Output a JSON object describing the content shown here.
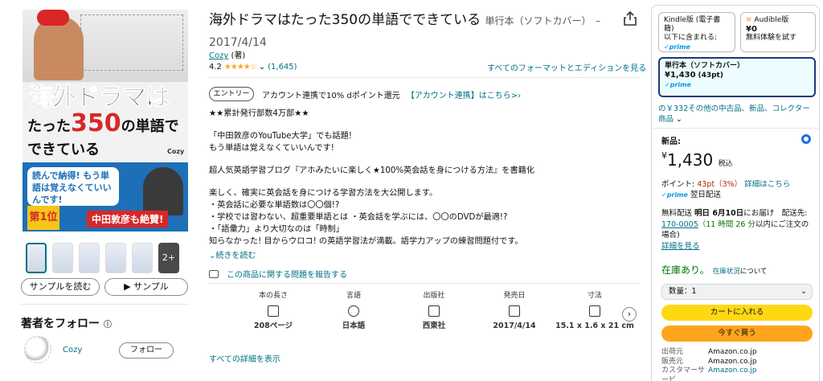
{
  "cover": {
    "title_line1": "海外ドラマは",
    "title_line2_a": "たった",
    "title_line2_num": "350",
    "title_line2_b": "の単語で",
    "title_line3": "できている",
    "brand": "Cozy",
    "bubble_text": "読んで納得! もう単語は覚えなくていいんです!",
    "rank_text": "第1位",
    "endorser": "中田敦彦も絶賛!"
  },
  "thumbnails": {
    "more_label": "2+"
  },
  "sample": {
    "read_label": "サンプルを読む",
    "play_label": "▶ サンプル"
  },
  "follow": {
    "title": "著者をフォロー",
    "author_name": "Cozy",
    "follow_label": "フォロー"
  },
  "product": {
    "title": "海外ドラマはたった350の単語でできている",
    "format": "単行本（ソフトカバー）",
    "dash": "–",
    "date": "2017/4/14",
    "author": "Cozy",
    "author_role": "(著)",
    "rating": "4.2",
    "stars": "★★★★☆",
    "rating_count": "(1,645)",
    "formats_link": "すべてのフォーマットとエディションを見る"
  },
  "entry": {
    "badge": "エントリー",
    "text": "アカウント連携で10% dポイント還元",
    "link": "【アカウント連携】はこちら>›"
  },
  "description": [
    "★★累計発行部数4万部★★",
    "",
    "「中田敦彦のYouTube大学」でも話題!",
    "もう単語は覚えなくていいんです!",
    "",
    "超人気英語学習ブログ『アホみたいに楽しく★100%英会話を身につける方法』を書籍化",
    "",
    "楽しく、確実に英会話を身につける学習方法を大公開します。",
    "・英会話に必要な単語数は〇〇個!?",
    "・学校では習わない、超重要単語とは ・英会話を学ぶには、〇〇のDVDが最適!?",
    "・「語彙力」より大切なのは「時制」",
    "知らなかった! 目からウロコ! の英語学習法が満載。語学力アップの練習問題付です。"
  ],
  "read_more": "続きを読む",
  "report": "この商品に関する問題を報告する",
  "details": [
    {
      "label": "本の長さ",
      "icon": "book-length-icon",
      "value": "208ページ"
    },
    {
      "label": "言語",
      "icon": "globe-icon",
      "value": "日本語"
    },
    {
      "label": "出版社",
      "icon": "building-icon",
      "value": "西東社"
    },
    {
      "label": "発売日",
      "icon": "calendar-icon",
      "value": "2017/4/14"
    },
    {
      "label": "寸法",
      "icon": "dimensions-icon",
      "value": "15.1 x 1.6 x 21 cm"
    }
  ],
  "all_details": "すべての詳細を表示",
  "buybox": {
    "kindle": {
      "name": "Kindle版 (電子書籍)",
      "sub": "以下に含まれる:",
      "prime": "✓prime"
    },
    "audible": {
      "name": "Audible版",
      "price": "¥0",
      "sub": "無料体験を試す"
    },
    "paper": {
      "name": "単行本（ソフトカバー）",
      "price": "¥1,430",
      "pt": "(43pt)",
      "prime": "✓prime"
    },
    "others": "の￥332その他の中古品、新品、コレクター商品",
    "new_label": "新品:",
    "price_yen": "¥",
    "price": "1,430",
    "tax": "税込",
    "points_label": "ポイント:",
    "points_value": "43pt（3%）",
    "points_link": "詳細はこちら",
    "prime_label": "✓prime",
    "prime_delivery": "翌日配送",
    "delivery_line1": "無料配送",
    "delivery_date": "明日 6月10日",
    "delivery_line1b": "にお届け　配送先:",
    "zip": "170-0005",
    "countdown": "（11 時間 26 分",
    "delivery_line2b": "以内にご注文の場合)",
    "details_link": "詳細を見る",
    "stock": "在庫あり。",
    "stock_link": "在庫状況",
    "stock_suffix": "について",
    "qty": "数量：1",
    "add_cart": "カートに入れる",
    "buy_now": "今すぐ買う",
    "seller_rows": [
      {
        "k": "出荷元",
        "v": "Amazon.co.jp"
      },
      {
        "k": "販売元",
        "v": "Amazon.co.jp"
      },
      {
        "k": "カスタマーサービ",
        "v": "Amazon.co.jp"
      }
    ]
  },
  "colors": {
    "link": "#007185",
    "cart": "#ffd814",
    "buy": "#ffa41c",
    "stock": "#007600",
    "price_red": "#b12704"
  }
}
